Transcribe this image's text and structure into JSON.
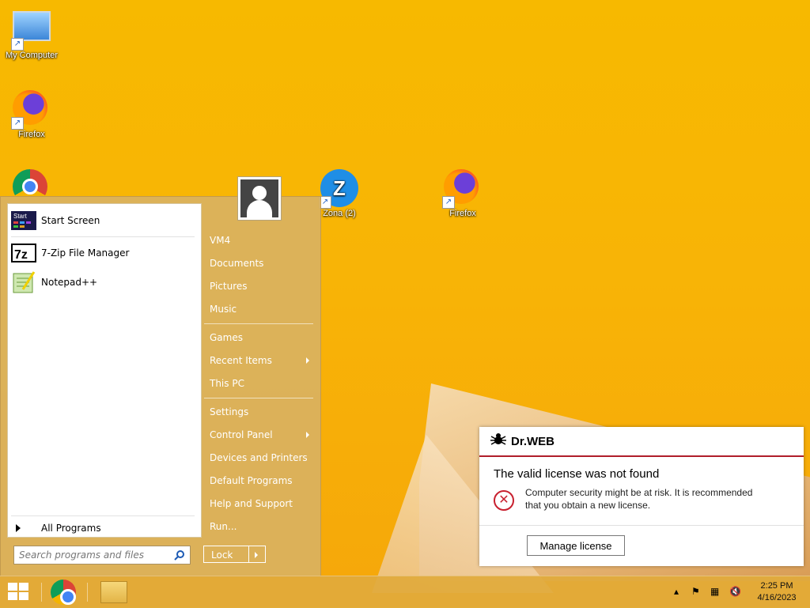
{
  "desktop": {
    "icons": [
      {
        "label": "My Computer"
      },
      {
        "label": "Firefox"
      },
      {
        "label": "Chrome"
      },
      {
        "label": "Zona (2)"
      },
      {
        "label": "Firefox"
      }
    ]
  },
  "start_menu": {
    "pinned": [
      {
        "label": "Start Screen",
        "icon": "start-screen-icon"
      },
      {
        "label": "7-Zip File Manager",
        "icon": "7zip-icon"
      },
      {
        "label": "Notepad++",
        "icon": "notepadpp-icon"
      }
    ],
    "all_programs": "All Programs",
    "search_placeholder": "Search programs and files",
    "right_items": [
      {
        "label": "VM4"
      },
      {
        "label": "Documents"
      },
      {
        "label": "Pictures"
      },
      {
        "label": "Music"
      },
      {
        "label": "Games"
      },
      {
        "label": "Recent Items"
      },
      {
        "label": "This PC"
      },
      {
        "label": "Settings"
      },
      {
        "label": "Control Panel"
      },
      {
        "label": "Devices and Printers"
      },
      {
        "label": "Default Programs"
      },
      {
        "label": "Help and Support"
      },
      {
        "label": "Run..."
      }
    ],
    "lock_label": "Lock"
  },
  "drweb": {
    "brand": "Dr.WEB",
    "title": "The valid license was not found",
    "message": "Computer security might be at risk. It is recommended that you obtain a new license.",
    "button": "Manage license"
  },
  "taskbar": {
    "time": "2:25 PM",
    "date": "4/16/2023"
  },
  "colors": {
    "accent_red": "#b01e2a",
    "menu_bg": "#d9b260"
  }
}
